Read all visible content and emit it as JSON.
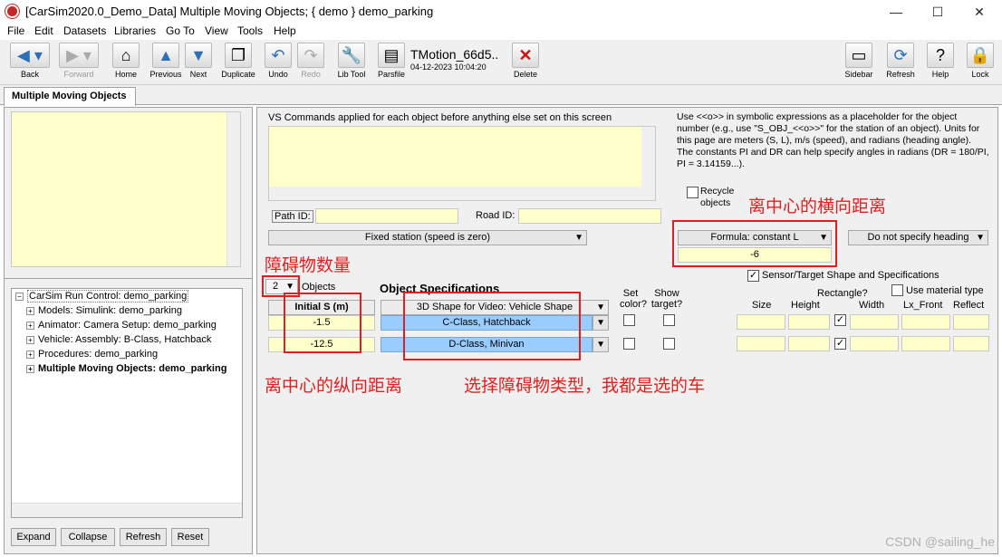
{
  "window": {
    "title": "[CarSim2020.0_Demo_Data] Multiple Moving Objects; { demo } demo_parking",
    "minimize": "—",
    "maximize": "☐",
    "close": "✕"
  },
  "menu": [
    "File",
    "Edit",
    "Datasets",
    "Libraries",
    "Go To",
    "View",
    "Tools",
    "Help"
  ],
  "toolbar": {
    "back": "Back",
    "forward": "Forward",
    "home": "Home",
    "previous": "Previous",
    "next": "Next",
    "duplicate": "Duplicate",
    "undo": "Undo",
    "redo": "Redo",
    "lib_tool": "Lib Tool",
    "parsfile": "Parsfile",
    "pars_name": "TMotion_66d5..",
    "pars_date": "04-12-2023 10:04:20",
    "delete": "Delete",
    "sidebar": "Sidebar",
    "refresh": "Refresh",
    "help": "Help",
    "lock": "Lock"
  },
  "tab": "Multiple Moving Objects",
  "tree": {
    "root": "CarSim Run Control: demo_parking",
    "items": [
      "Models: Simulink: demo_parking",
      "Animator: Camera Setup: demo_parking",
      "Vehicle: Assembly: B-Class, Hatchback",
      "Procedures: demo_parking",
      "Multiple Moving Objects: demo_parking"
    ],
    "plus": "+",
    "minus": "−"
  },
  "left_buttons": {
    "expand": "Expand",
    "collapse": "Collapse",
    "refresh": "Refresh",
    "reset": "Reset"
  },
  "main": {
    "vs_commands_label": "VS Commands applied for each object before anything else set on this screen",
    "help_text": "Use <<o>> in symbolic expressions as a placeholder for the object number (e.g., use \"S_OBJ_<<o>>\" for the station of an object). Units for this page are meters (S, L), m/s (speed), and radians (heading angle). The constants PI and DR can help specify angles in radians (DR = 180/PI, PI = 3.14159...).",
    "recycle_objects": "Recycle objects",
    "path_id_label": "Path ID:",
    "road_id_label": "Road ID:",
    "station_mode": "Fixed station (speed is zero)",
    "lateral_mode": "Formula: constant L",
    "lateral_value": "-6",
    "heading_mode": "Do not specify heading",
    "sensor_label": "Sensor/Target Shape and Specifications",
    "object_count": "2",
    "objects_label": "Objects",
    "object_spec_label": "Object Specifications",
    "initial_s_header": "Initial S (m)",
    "shape_header": "3D Shape for Video: Vehicle Shape",
    "set_color": "Set color?",
    "show_target": "Show target?",
    "rectangle": "Rectangle?",
    "use_material": "Use material type",
    "columns": [
      "Size",
      "Height",
      "Width",
      "Lx_Front",
      "Reflect"
    ],
    "rows": [
      {
        "initial_s": "-1.5",
        "shape": "C-Class, Hatchback"
      },
      {
        "initial_s": "-12.5",
        "shape": "D-Class, Minivan"
      }
    ],
    "checkmark": "✓"
  },
  "annotations": {
    "lateral": "离中心的横向距离",
    "count": "障碍物数量",
    "longitudinal": "离中心的纵向距离",
    "type": "选择障碍物类型，我都是选的车"
  },
  "watermark": "CSDN @sailing_he",
  "colors": {
    "field_yellow": "#ffffcc",
    "dropdown_blue": "#99ccff",
    "annotation_red": "#e02020"
  }
}
